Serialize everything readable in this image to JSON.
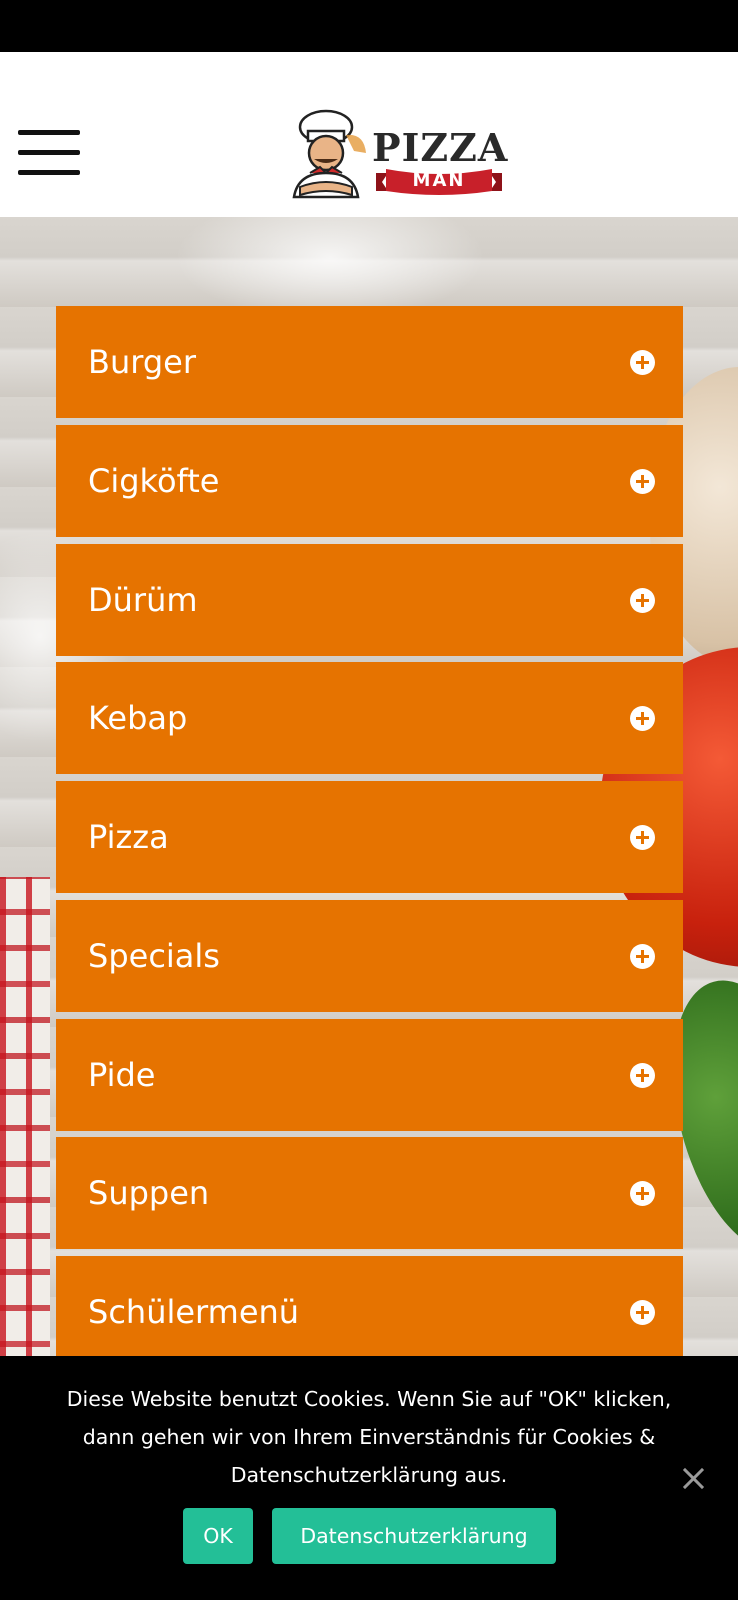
{
  "header": {
    "logo": {
      "title": "PIZZA",
      "subtitle": "MAN"
    }
  },
  "menu": {
    "items": [
      {
        "label": "Burger"
      },
      {
        "label": "Cigköfte"
      },
      {
        "label": "Dürüm"
      },
      {
        "label": "Kebap"
      },
      {
        "label": "Pizza"
      },
      {
        "label": "Specials"
      },
      {
        "label": "Pide"
      },
      {
        "label": "Suppen"
      },
      {
        "label": "Schülermenü"
      }
    ]
  },
  "cookie_banner": {
    "line1": "Diese Website benutzt Cookies. Wenn Sie auf \"OK\" klicken,",
    "line2": "dann gehen wir von Ihrem Einverständnis für Cookies &",
    "line3": "Datenschutzerklärung aus.",
    "ok_label": "OK",
    "privacy_label": "Datenschutzerklärung"
  },
  "colors": {
    "accent_orange": "#e67300",
    "button_teal": "#23bf97",
    "ribbon_red": "#c8202a"
  },
  "icons": [
    "hamburger-menu-icon",
    "plus-circle-icon",
    "close-icon",
    "chef-mascot-icon"
  ]
}
